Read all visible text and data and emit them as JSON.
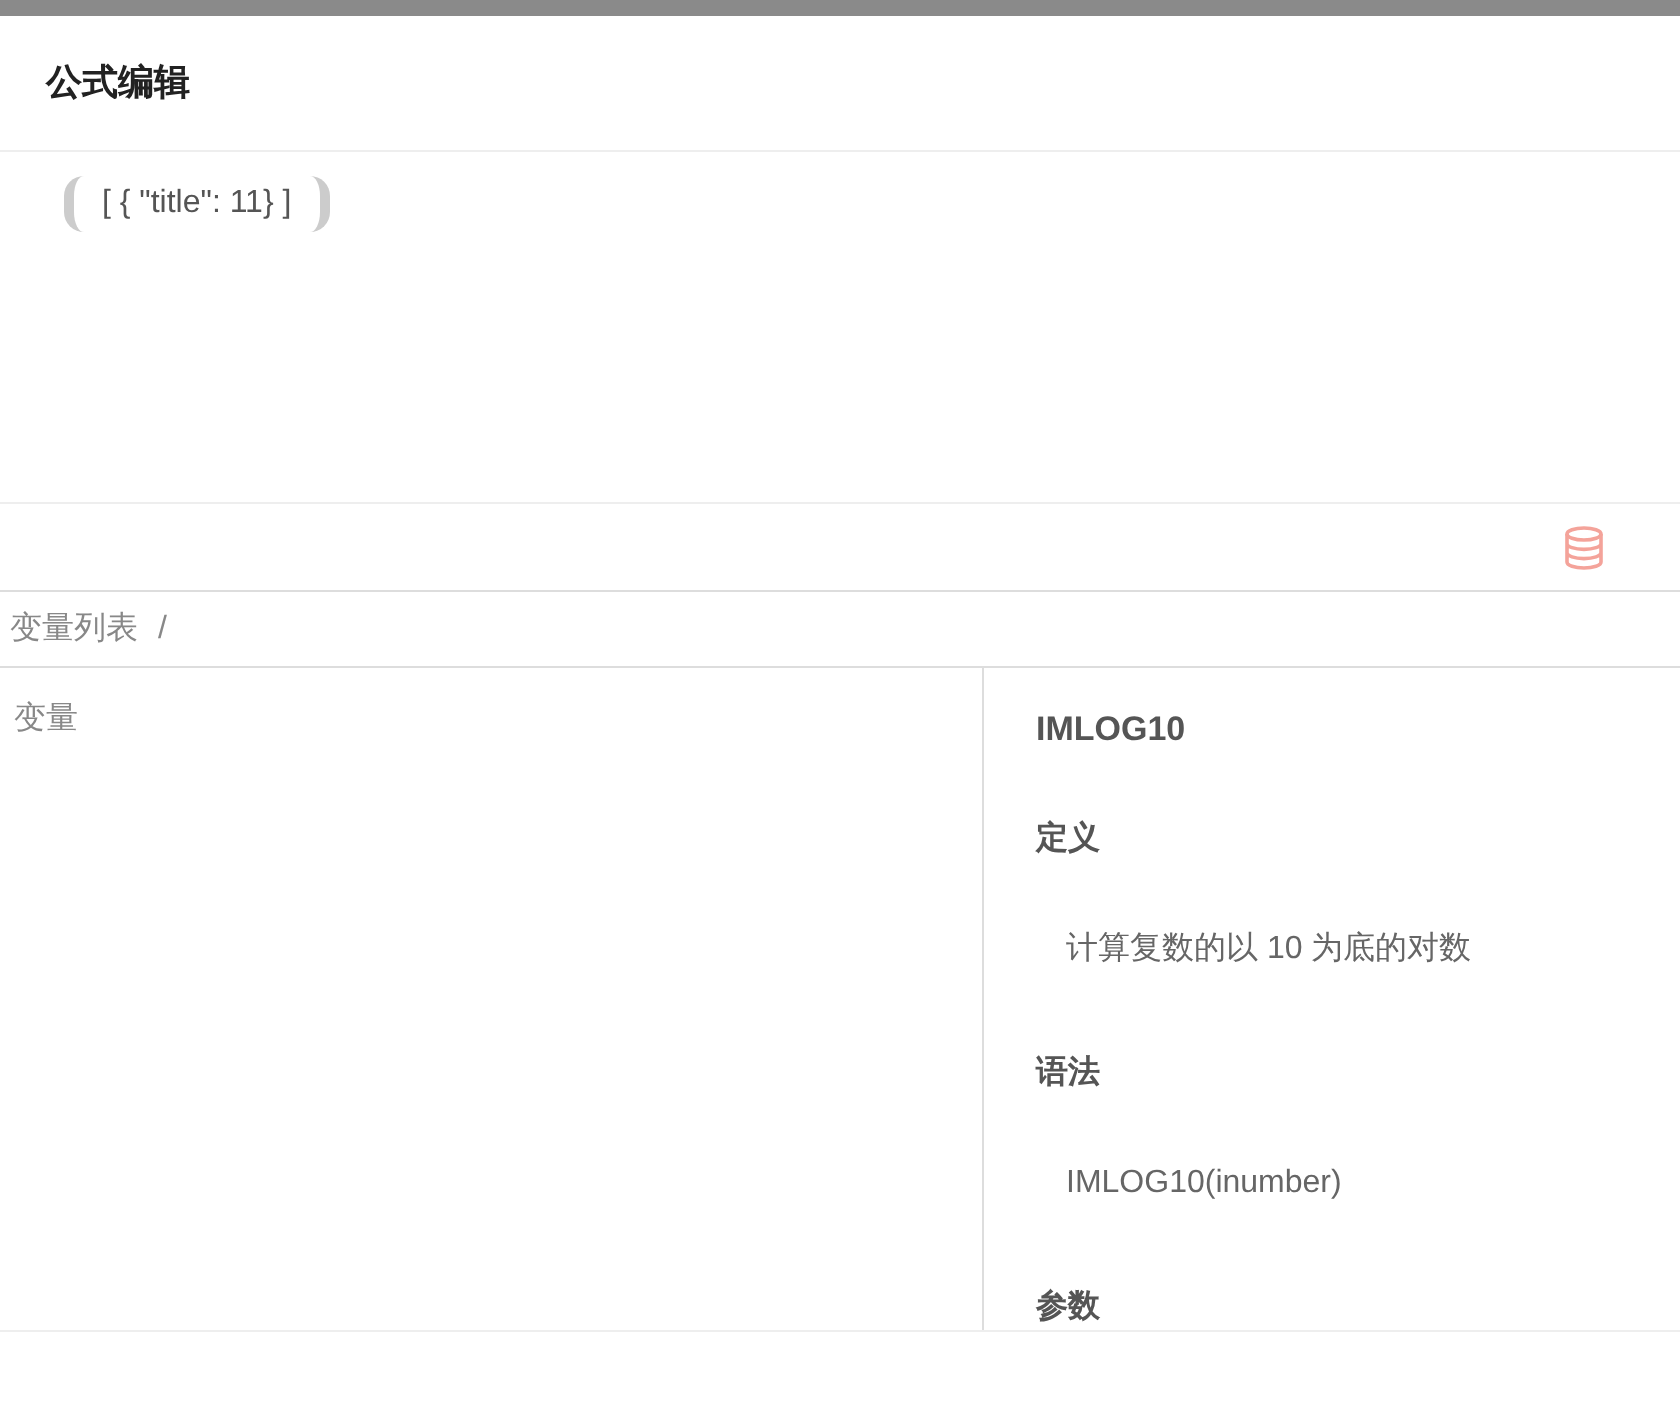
{
  "dialog": {
    "title": "公式编辑"
  },
  "formula": {
    "text": "[ { \"title\": 11} ]"
  },
  "breadcrumb": {
    "items": [
      "变量列表"
    ],
    "separator": "/"
  },
  "variables": {
    "heading": "变量"
  },
  "help": {
    "name": "IMLOG10",
    "sections": [
      {
        "heading": "定义",
        "body": "计算复数的以 10 为底的对数"
      },
      {
        "heading": "语法",
        "body": "IMLOG10(inumber)"
      },
      {
        "heading": "参数"
      }
    ]
  }
}
